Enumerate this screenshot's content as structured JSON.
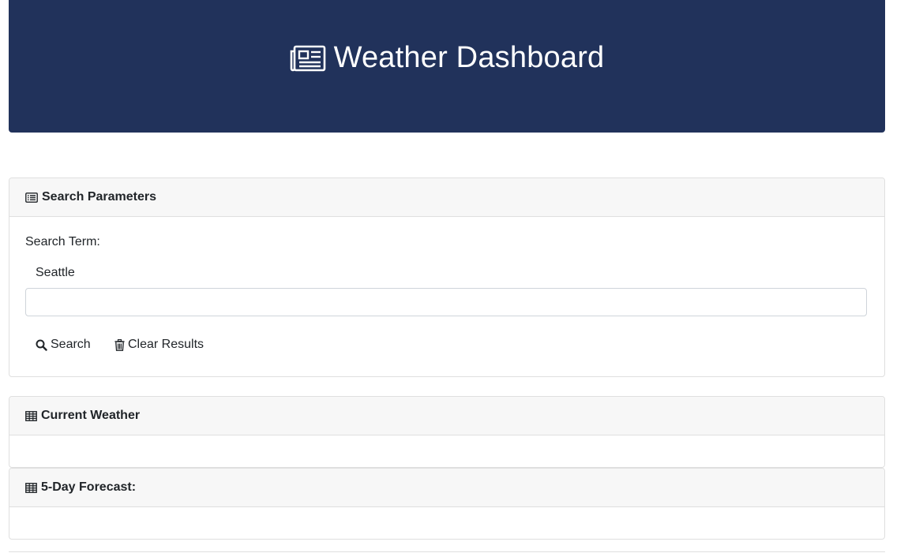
{
  "header": {
    "title": "Weather Dashboard",
    "icon": "newspaper-icon",
    "background": "#21325b"
  },
  "search_panel": {
    "title": "Search Parameters",
    "icon": "list-alt-icon",
    "search_term_label": "Search Term:",
    "search_term_value": "Seattle",
    "input_value": "",
    "search_button": "Search",
    "search_icon": "search-icon",
    "clear_button": "Clear Results",
    "clear_icon": "trash-icon"
  },
  "current_panel": {
    "title": "Current Weather",
    "icon": "table-icon"
  },
  "forecast_panel": {
    "title": "5-Day Forecast:",
    "icon": "table-icon"
  }
}
